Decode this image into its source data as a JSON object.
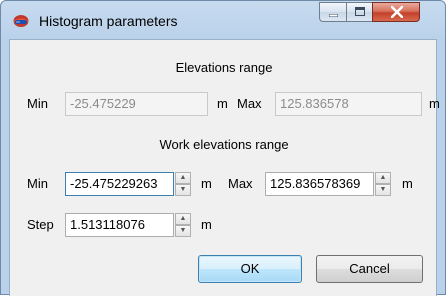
{
  "window": {
    "title": "Histogram parameters"
  },
  "elevations_range": {
    "heading": "Elevations range",
    "min_label": "Min",
    "min_value": "-25.475229",
    "max_label": "Max",
    "max_value": "125.836578",
    "unit": "m"
  },
  "work_range": {
    "heading": "Work elevations range",
    "min_label": "Min",
    "min_value": "-25.475229263",
    "max_label": "Max",
    "max_value": "125.836578369",
    "unit": "m",
    "step_label": "Step",
    "step_value": "1.513118076"
  },
  "buttons": {
    "ok": "OK",
    "cancel": "Cancel"
  },
  "icons": {
    "app": "histogram-app-icon",
    "minimize": "minimize-icon",
    "maximize": "maximize-icon",
    "close": "close-icon"
  }
}
